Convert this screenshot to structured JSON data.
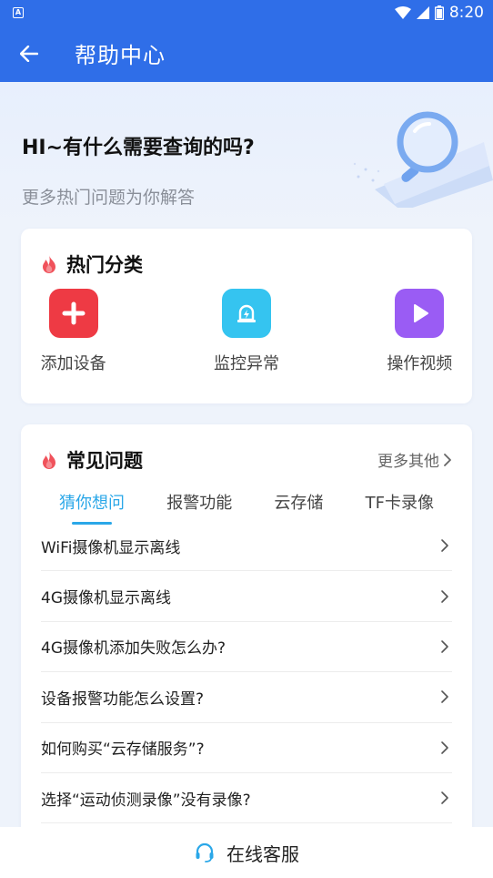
{
  "status_bar": {
    "time": "8:20"
  },
  "header": {
    "title": "帮助中心"
  },
  "hero": {
    "title": "HI~有什么需要查询的吗?",
    "subtitle": "更多热门问题为你解答"
  },
  "hot_categories": {
    "title": "热门分类",
    "items": [
      {
        "label": "添加设备",
        "icon": "plus-icon",
        "color": "#ee3a44"
      },
      {
        "label": "监控异常",
        "icon": "alert-light-icon",
        "color": "#35c4f0"
      },
      {
        "label": "操作视频",
        "icon": "play-icon",
        "color": "#9a5cf4"
      }
    ]
  },
  "faq": {
    "title": "常见问题",
    "more_label": "更多其他",
    "tabs": [
      "猜你想问",
      "报警功能",
      "云存储",
      "TF卡录像"
    ],
    "active_tab": 0,
    "items": [
      "WiFi摄像机显示离线",
      "4G摄像机显示离线",
      "4G摄像机添加失败怎么办?",
      "设备报警功能怎么设置?",
      "如何购买“云存储服务”?",
      "选择“运动侦测录像”没有录像?"
    ]
  },
  "bottom": {
    "label": "在线客服"
  },
  "colors": {
    "primary": "#2f6ee8",
    "accent": "#2aa7e8",
    "fire": "#f0525b"
  }
}
